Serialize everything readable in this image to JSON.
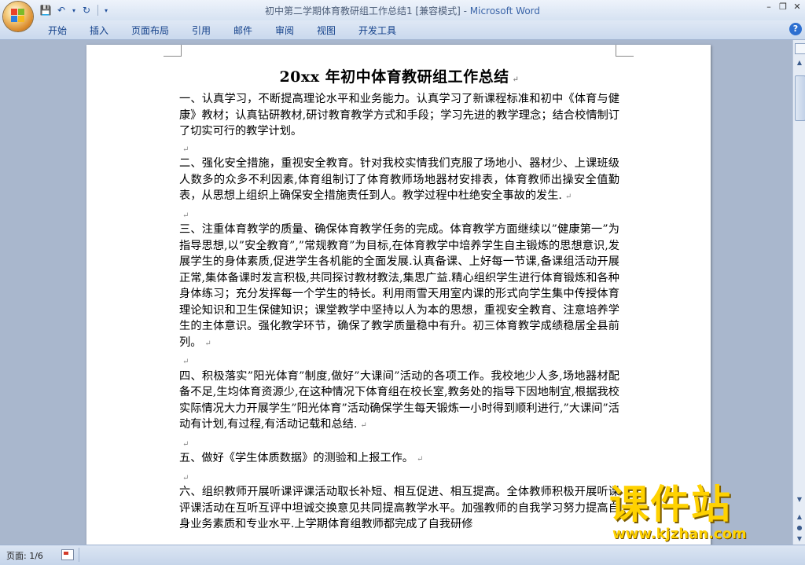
{
  "window": {
    "title": "初中第二学期体育教研组工作总结1 [兼容模式] - ",
    "app_name": "Microsoft Word"
  },
  "quick_access": {
    "save_icon": "save-icon",
    "undo_icon": "undo-icon",
    "redo_icon": "redo-icon"
  },
  "ribbon": {
    "tabs": [
      "开始",
      "插入",
      "页面布局",
      "引用",
      "邮件",
      "审阅",
      "视图",
      "开发工具"
    ]
  },
  "document": {
    "title": "20xx 年初中体育教研组工作总结",
    "paragraphs": [
      "一、认真学习，不断提高理论水平和业务能力。认真学习了新课程标准和初中《体育与健康》教材；认真钻研教材,研讨教育教学方式和手段；学习先进的教学理念；结合校情制订了切实可行的教学计划。",
      "二、强化安全措施，重视安全教育。针对我校实情我们克服了场地小、器材少、上课班级人数多的众多不利因素,体育组制订了体育教师场地器材安排表，体育教师出操安全值勤表，从思想上组织上确保安全措施责任到人。教学过程中杜绝安全事故的发生.",
      "三、注重体育教学的质量、确保体育教学任务的完成。体育教学方面继续以”健康第一”为指导思想,以”安全教育”,”常规教育”为目标,在体育教学中培养学生自主锻炼的思想意识,发展学生的身体素质,促进学生各机能的全面发展.认真备课、上好每一节课,备课组活动开展正常,集体备课时发言积极,共同探讨教材教法,集思广益.精心组织学生进行体育锻炼和各种身体练习；充分发挥每一个学生的特长。利用雨雪天用室内课的形式向学生集中传授体育理论知识和卫生保健知识；课堂教学中坚持以人为本的思想，重视安全教育、注意培养学生的主体意识。强化教学环节，确保了教学质量稳中有升。初三体育教学成绩稳居全县前列。",
      "四、积极落实”阳光体育”制度,做好”大课间”活动的各项工作。我校地少人多,场地器材配备不足,生均体育资源少,在这种情况下体育组在校长室,教务处的指导下因地制宜,根据我校实际情况大力开展学生”阳光体育”活动确保学生每天锻炼一小时得到顺利进行,”大课间”活动有计划,有过程,有活动记载和总结.",
      "五、做好《学生体质数据》的测验和上报工作。",
      "六、组织教师开展听课评课活动取长补短、相互促进、相互提高。全体教师积极开展听课评课活动在互听互评中坦诚交换意见共同提高教学水平。加强教师的自我学习努力提高自身业务素质和专业水平.上学期体育组教师都完成了自我研修"
    ]
  },
  "status_bar": {
    "page": "页面: 1/6"
  },
  "watermark": {
    "big": "课件站",
    "small": "www.kjzhan.com"
  }
}
